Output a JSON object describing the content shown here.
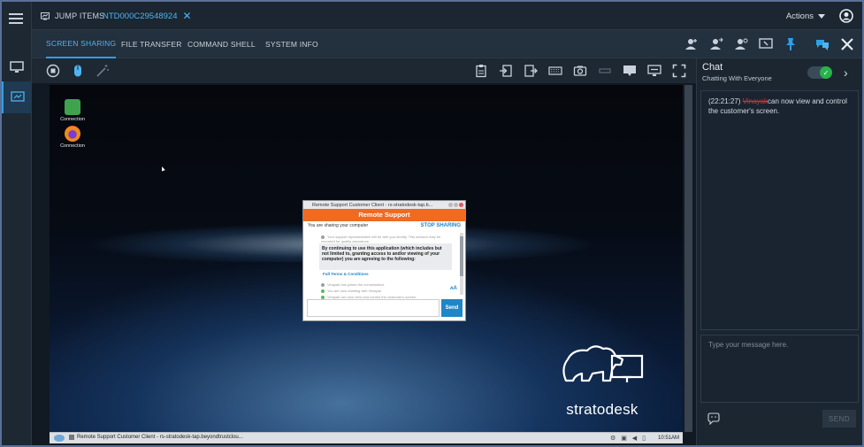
{
  "topbar": {
    "jump_items_label": "JUMP ITEMS",
    "session_tab_label": "NTD000C29548924",
    "actions_label": "Actions"
  },
  "subtabs": [
    {
      "label": "SCREEN SHARING",
      "active": true
    },
    {
      "label": "FILE TRANSFER",
      "active": false
    },
    {
      "label": "COMMAND SHELL",
      "active": false
    },
    {
      "label": "SYSTEM INFO",
      "active": false
    }
  ],
  "remote": {
    "desktop_icons": [
      {
        "label": "Connection",
        "icon": "connection-icon"
      },
      {
        "label": "Connection",
        "icon": "firefox-icon"
      }
    ],
    "taskbar_task": "Remote Support Customer Client - rs-stratodesk-tap.beyondtrustclou...",
    "clock": "10:51AM",
    "brand": "stratodesk",
    "dialog": {
      "title": "Remote Support Customer Client - rs-stratodesk-tap.b...",
      "banner": "Remote Support",
      "sharing_text": "You are sharing your computer",
      "stop_label": "STOP SHARING",
      "faded_text": "Your support representative will be with you shortly. This session may be recorded for quality assurance.",
      "notice": "By continuing to use this application (which includes but not limited to, granting access to and/or viewing of your computer) you are agreeing to the following:",
      "terms_link": "Full Terms & Conditions",
      "log": [
        "Vinayak has joined the conversation.",
        "You are now chatting with Vinayak.",
        "Vinayak can now view and control the customer's screen."
      ],
      "font_size_label": "ᴀA",
      "send_label": "Send"
    }
  },
  "chat": {
    "title": "Chat",
    "subtitle": "Chatting With Everyone",
    "message_time": "(22:21:27)",
    "message_name": "Vinayak",
    "message_text": "can now view and control the customer's screen.",
    "input_placeholder": "Type your message here.",
    "send_label": "SEND"
  },
  "colors": {
    "accent": "#2f9fe6",
    "banner": "#f06a1f",
    "toggle_on": "#27b34a"
  }
}
